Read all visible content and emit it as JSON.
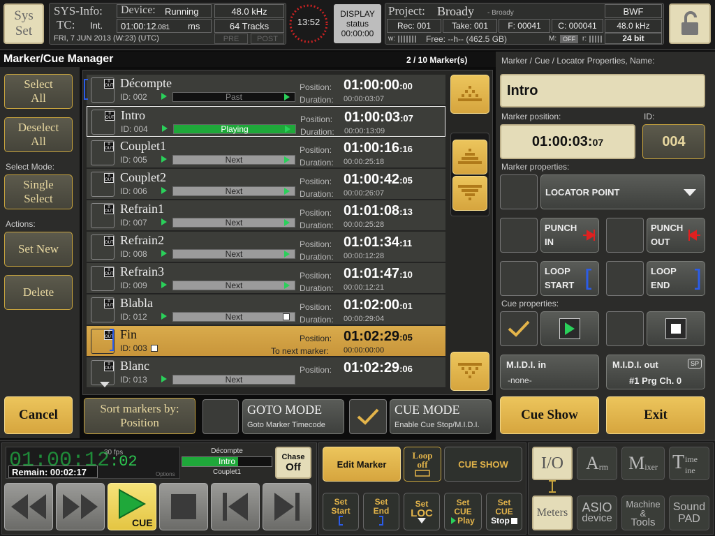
{
  "topbar": {
    "sys_set": [
      "Sys",
      "Set"
    ],
    "sysinfo": "SYS-Info:",
    "device_label": "Device:",
    "device_state": "Running",
    "sample_rate": "48.0 kHz",
    "tc_label": "TC:",
    "tc_source": "Int.",
    "tc_value": "01:00:12",
    "tc_frames": ".081",
    "ms": "ms",
    "tracks": "64 Tracks",
    "date": "FRI, 7 JUN 2013 (W:23) (UTC)",
    "pre": "PRE",
    "post": "POST",
    "clock": "13:52",
    "display": "DISPLAY",
    "status": "status",
    "display_time": "00:00:00",
    "project_label": "Project:",
    "project_name": "Broady",
    "project_sub": "- Broady",
    "format": "BWF",
    "rec": "Rec: 001",
    "take": "Take: 001",
    "f": "F: 00041",
    "c": "C: 000041",
    "rate2": "48.0 kHz",
    "w": "w:",
    "free": "Free: --h-- (462.5 GB)",
    "m": "M:",
    "off": "OFF",
    "r": "r:",
    "bits": "24 bit"
  },
  "manager": {
    "title": "Marker/Cue Manager",
    "count": "2 / 10 Marker(s)"
  },
  "left": {
    "select_all": "Select All",
    "deselect_all": "Deselect All",
    "select_mode_label": "Select Mode:",
    "single_select": "Single Select",
    "actions_label": "Actions:",
    "set_new": "Set New",
    "delete": "Delete",
    "cancel": "Cancel"
  },
  "markers": [
    {
      "name": "Décompte",
      "id": "ID: 002",
      "state": "Past",
      "pos": "01:00:00",
      "posf": "00",
      "dur": "00:00:03:07"
    },
    {
      "name": "Intro",
      "id": "ID: 004",
      "state": "Playing",
      "pos": "01:00:03",
      "posf": "07",
      "dur": "00:00:13:09"
    },
    {
      "name": "Couplet1",
      "id": "ID: 005",
      "state": "Next",
      "pos": "01:00:16",
      "posf": "16",
      "dur": "00:00:25:18"
    },
    {
      "name": "Couplet2",
      "id": "ID: 006",
      "state": "Next",
      "pos": "01:00:42",
      "posf": "05",
      "dur": "00:00:26:07"
    },
    {
      "name": "Refrain1",
      "id": "ID: 007",
      "state": "Next",
      "pos": "01:01:08",
      "posf": "13",
      "dur": "00:00:25:28"
    },
    {
      "name": "Refrain2",
      "id": "ID: 008",
      "state": "Next",
      "pos": "01:01:34",
      "posf": "11",
      "dur": "00:00:12:28"
    },
    {
      "name": "Refrain3",
      "id": "ID: 009",
      "state": "Next",
      "pos": "01:01:47",
      "posf": "10",
      "dur": "00:00:12:21"
    },
    {
      "name": "Blabla",
      "id": "ID: 012",
      "state": "Next",
      "pos": "01:02:00",
      "posf": "01",
      "dur": "00:00:29:04"
    },
    {
      "name": "Fin",
      "id": "ID: 003",
      "state": "",
      "pos": "01:02:29",
      "posf": "05",
      "dur": "00:00:00:00"
    },
    {
      "name": "Blanc",
      "id": "ID: 013",
      "state": "Next",
      "pos": "01:02:29",
      "posf": "06",
      "dur": ""
    }
  ],
  "row_labels": {
    "position": "Position:",
    "duration": "Duration:",
    "to_next": "To next marker:"
  },
  "sort": {
    "label": "Sort markers by:",
    "value": "Position"
  },
  "goto": {
    "title": "GOTO MODE",
    "sub": "Goto Marker Timecode"
  },
  "cue": {
    "title": "CUE MODE",
    "sub": "Enable Cue Stop/M.I.D.I."
  },
  "props": {
    "header": "Marker / Cue / Locator Properties, Name:",
    "name": "Intro",
    "pos_label": "Marker position:",
    "pos_value": "01:00:03:",
    "pos_frames": "07",
    "id_label": "ID:",
    "id_value": "004",
    "mp_label": "Marker properties:",
    "locator": "LOCATOR POINT",
    "punch_in": [
      "PUNCH",
      "IN"
    ],
    "punch_out": [
      "PUNCH",
      "OUT"
    ],
    "loop_start": [
      "LOOP",
      "START"
    ],
    "loop_end": [
      "LOOP",
      "END"
    ],
    "cp_label": "Cue properties:",
    "midi_in": "M.I.D.I. in",
    "midi_in_val": "-none-",
    "midi_out": "M.I.D.I. out",
    "sp": "SP",
    "midi_out_val": "#1 Prg Ch. 0",
    "cue_show": "Cue Show",
    "exit": "Exit"
  },
  "transport": {
    "tc": "01:00:12",
    "tcf": ":02",
    "fps": "30 fps",
    "remain": "Remain: 00:02:17",
    "options": "Options",
    "prev_marker": "Décompte",
    "cur_marker": "Intro",
    "next_marker": "Couplet1",
    "chase": "Chase",
    "chase_val": "Off",
    "cue": "CUE"
  },
  "mid": {
    "edit_marker": "Edit Marker",
    "loop": "Loop",
    "loop_off": "off",
    "cue_show": "CUE SHOW",
    "set_start": [
      "Set",
      "Start"
    ],
    "set_end": [
      "Set",
      "End"
    ],
    "set_loc": [
      "Set",
      "LOC"
    ],
    "set_cue_play": [
      "Set",
      "CUE",
      "Play"
    ],
    "set_cue_stop": [
      "Set",
      "CUE",
      "Stop"
    ]
  },
  "nav": {
    "io": "I/O",
    "arm": "A",
    "arm_s": "rm",
    "mixer": "M",
    "mixer_s": "ixer",
    "time": "T",
    "time_s": "ime",
    "line_s": "ine",
    "meters": "Meters",
    "asio": [
      "ASIO",
      "device"
    ],
    "machine": [
      "Machine",
      "&",
      "Tools"
    ],
    "sound": [
      "Sound",
      "PAD"
    ]
  }
}
